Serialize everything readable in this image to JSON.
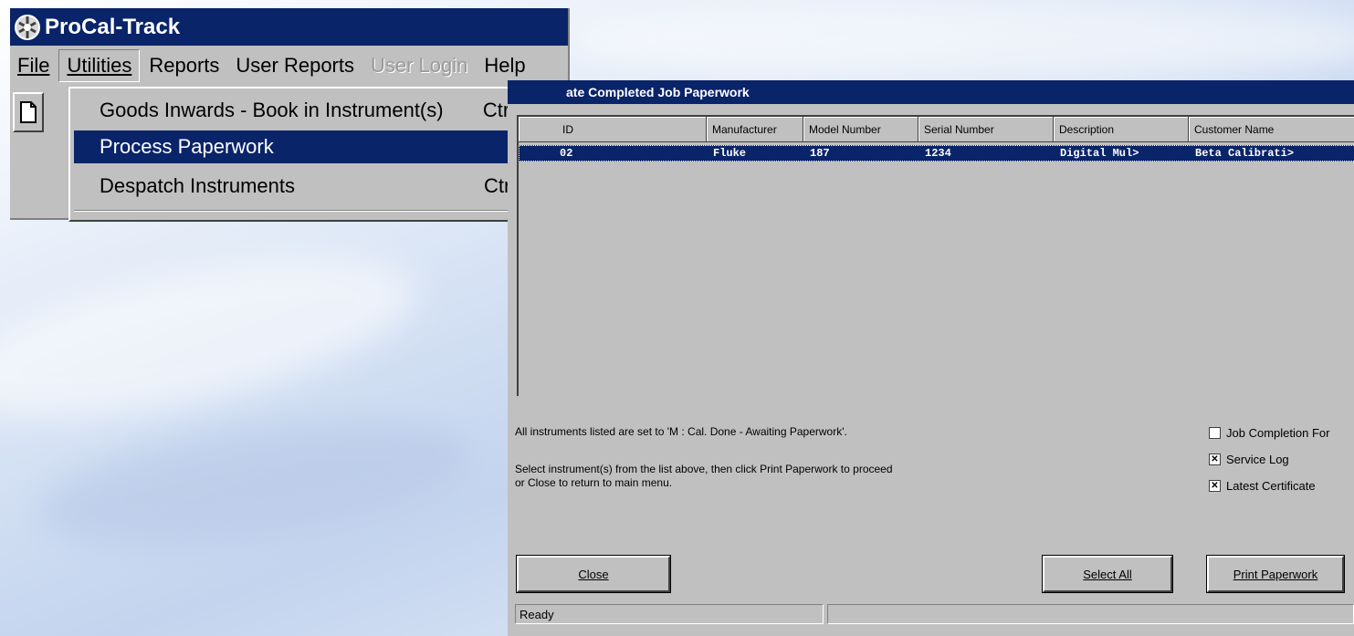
{
  "app": {
    "title": "ProCal-Track",
    "menu": [
      "File",
      "Utilities",
      "Reports",
      "User Reports",
      "User Login",
      "Help"
    ]
  },
  "utilities_menu": {
    "items": [
      {
        "label": "Goods Inwards - Book in Instrument(s)",
        "shortcut": "Ctrl+G"
      },
      {
        "label": "Process Paperwork",
        "shortcut": ""
      },
      {
        "label": "Despatch Instruments",
        "shortcut": "Ctrl+D"
      }
    ]
  },
  "dialog": {
    "title": "ate Completed Job Paperwork",
    "columns": [
      "ID",
      "Manufacturer",
      "Model Number",
      "Serial Number",
      "Description",
      "Customer Name"
    ],
    "rows": [
      [
        "02",
        "Fluke",
        "187",
        "1234",
        "Digital Mul>",
        "Beta Calibrati>"
      ]
    ],
    "info_line1": "All instruments listed are set to 'M : Cal. Done - Awaiting Paperwork'.",
    "info_line2": "Select instrument(s) from the list above, then click Print Paperwork to proceed",
    "info_line3": "or Close to return to main menu.",
    "options": [
      {
        "label": "Job Completion For",
        "checked": false
      },
      {
        "label": "Service Log",
        "checked": true
      },
      {
        "label": "Latest Certificate",
        "checked": true
      }
    ],
    "buttons": {
      "close": "Close",
      "select_all": "Select All",
      "print": "Print Paperwork"
    },
    "status": "Ready"
  }
}
